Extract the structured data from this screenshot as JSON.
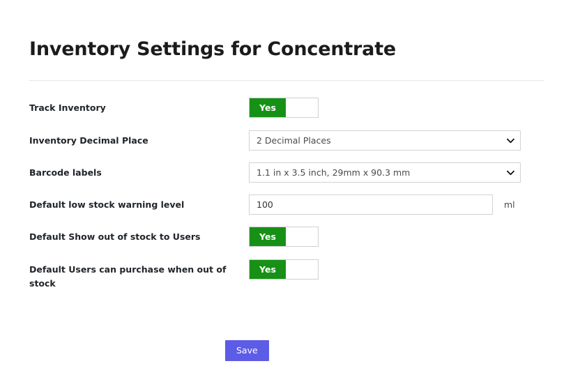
{
  "page": {
    "title": "Inventory Settings for Concentrate"
  },
  "form": {
    "rows": [
      {
        "label": "Track Inventory",
        "type": "toggle",
        "value": "Yes"
      },
      {
        "label": "Inventory Decimal Place",
        "type": "select",
        "value": "2 Decimal Places"
      },
      {
        "label": "Barcode labels",
        "type": "select",
        "value": "1.1 in x 3.5 inch, 29mm x 90.3 mm"
      },
      {
        "label": "Default low stock warning level",
        "type": "text",
        "value": "100",
        "unit": "ml"
      },
      {
        "label": "Default Show out of stock to Users",
        "type": "toggle",
        "value": "Yes"
      },
      {
        "label": "Default Users can purchase when out of stock",
        "type": "toggle",
        "value": "Yes"
      }
    ]
  },
  "actions": {
    "save_label": "Save"
  },
  "icons": {
    "chevron_down": "chevron-down-icon"
  },
  "colors": {
    "toggle_on": "#169116",
    "save_button": "#5c5ce6",
    "divider": "#e6e6e6",
    "border": "#d2d2d2"
  }
}
